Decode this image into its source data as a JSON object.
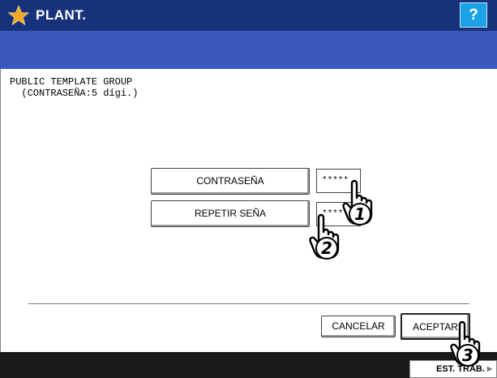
{
  "header": {
    "title": "PLANT.",
    "help_label": "?"
  },
  "panel": {
    "group_line": "PUBLIC TEMPLATE GROUP",
    "hint_line": "  (CONTRASEÑA:5 dígi.)"
  },
  "form": {
    "password_label": "CONTRASEÑA",
    "password_value": "*****",
    "repeat_label": "REPETIR SEÑA",
    "repeat_value": "*****"
  },
  "actions": {
    "cancel_label": "CANCELAR",
    "accept_label": "ACEPTAR"
  },
  "footer": {
    "status_label": "EST. TRAB."
  },
  "callouts": {
    "step1": "1",
    "step2": "2",
    "step3": "3"
  },
  "icons": [
    "star-icon",
    "help-icon",
    "hand-pointer-icon",
    "arrow-right-icon"
  ],
  "colors": {
    "titlebar": "#17327a",
    "bluebar": "#3b58bf",
    "help": "#1aa2e6",
    "star": "#f5a623",
    "bottombar": "#1a1a1a"
  }
}
